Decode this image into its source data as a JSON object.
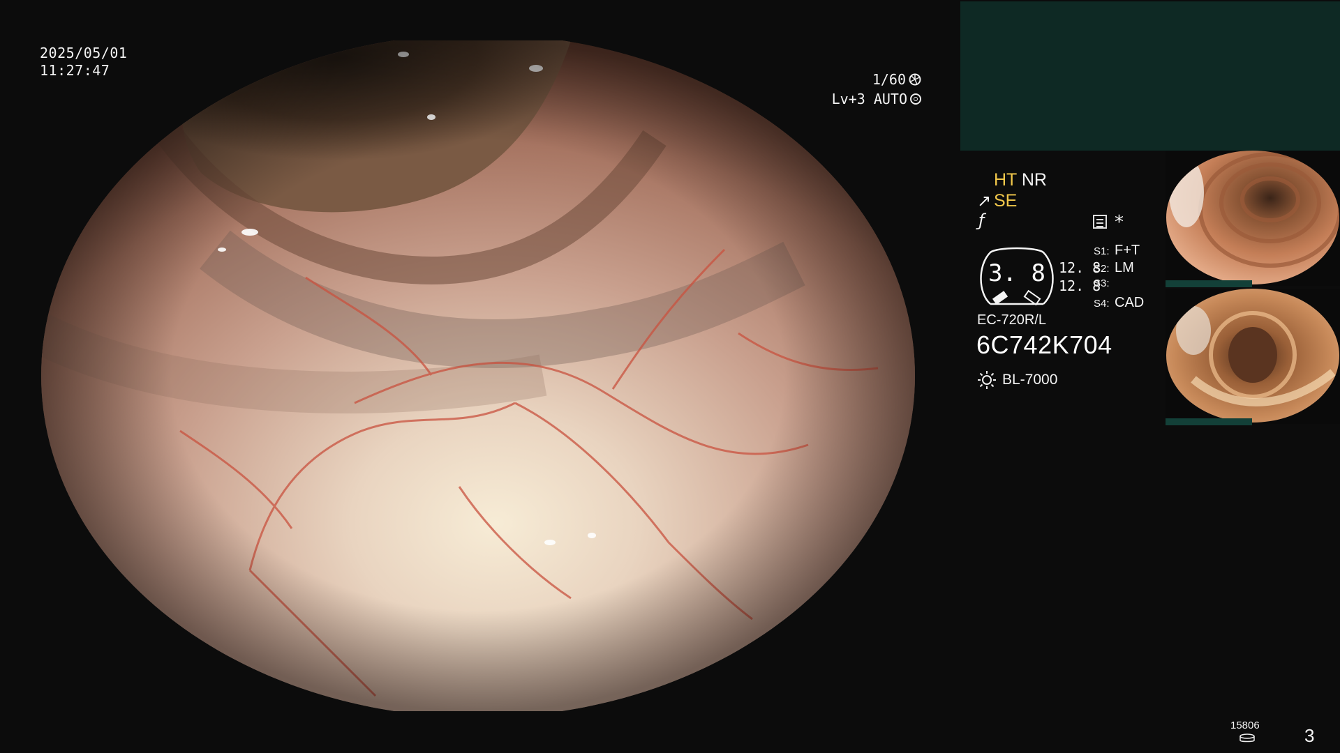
{
  "overlay": {
    "date": "2025/05/01",
    "time": "11:27:47",
    "shutter": "1/60",
    "level_mode": "Lv+3 AUTO"
  },
  "panel": {
    "ht": "HT",
    "nr": "NR",
    "se": "SE",
    "zoom_value": "3. 8",
    "scale_top": "12. 8",
    "scale_bottom": "12. 8",
    "switches": [
      {
        "key": "S1:",
        "value": "F+T"
      },
      {
        "key": "S2:",
        "value": "LM"
      },
      {
        "key": "S3:",
        "value": ""
      },
      {
        "key": "S4:",
        "value": "CAD"
      }
    ],
    "scope_model": "EC-720R/L",
    "serial": "6C742K704",
    "light_source": "BL-7000"
  },
  "footer": {
    "counter": "15806",
    "page": "3"
  },
  "colors": {
    "accent_yellow": "#f2c84b",
    "teal_box": "#0e2924",
    "thumb_bar": "#134038",
    "background": "#0c0c0c"
  },
  "icons": [
    "shutter-icon",
    "auto-iris-icon",
    "scope-adjust-icon",
    "freeze-icon",
    "memo-icon",
    "asterisk-icon",
    "light-source-icon",
    "disk-icon"
  ]
}
